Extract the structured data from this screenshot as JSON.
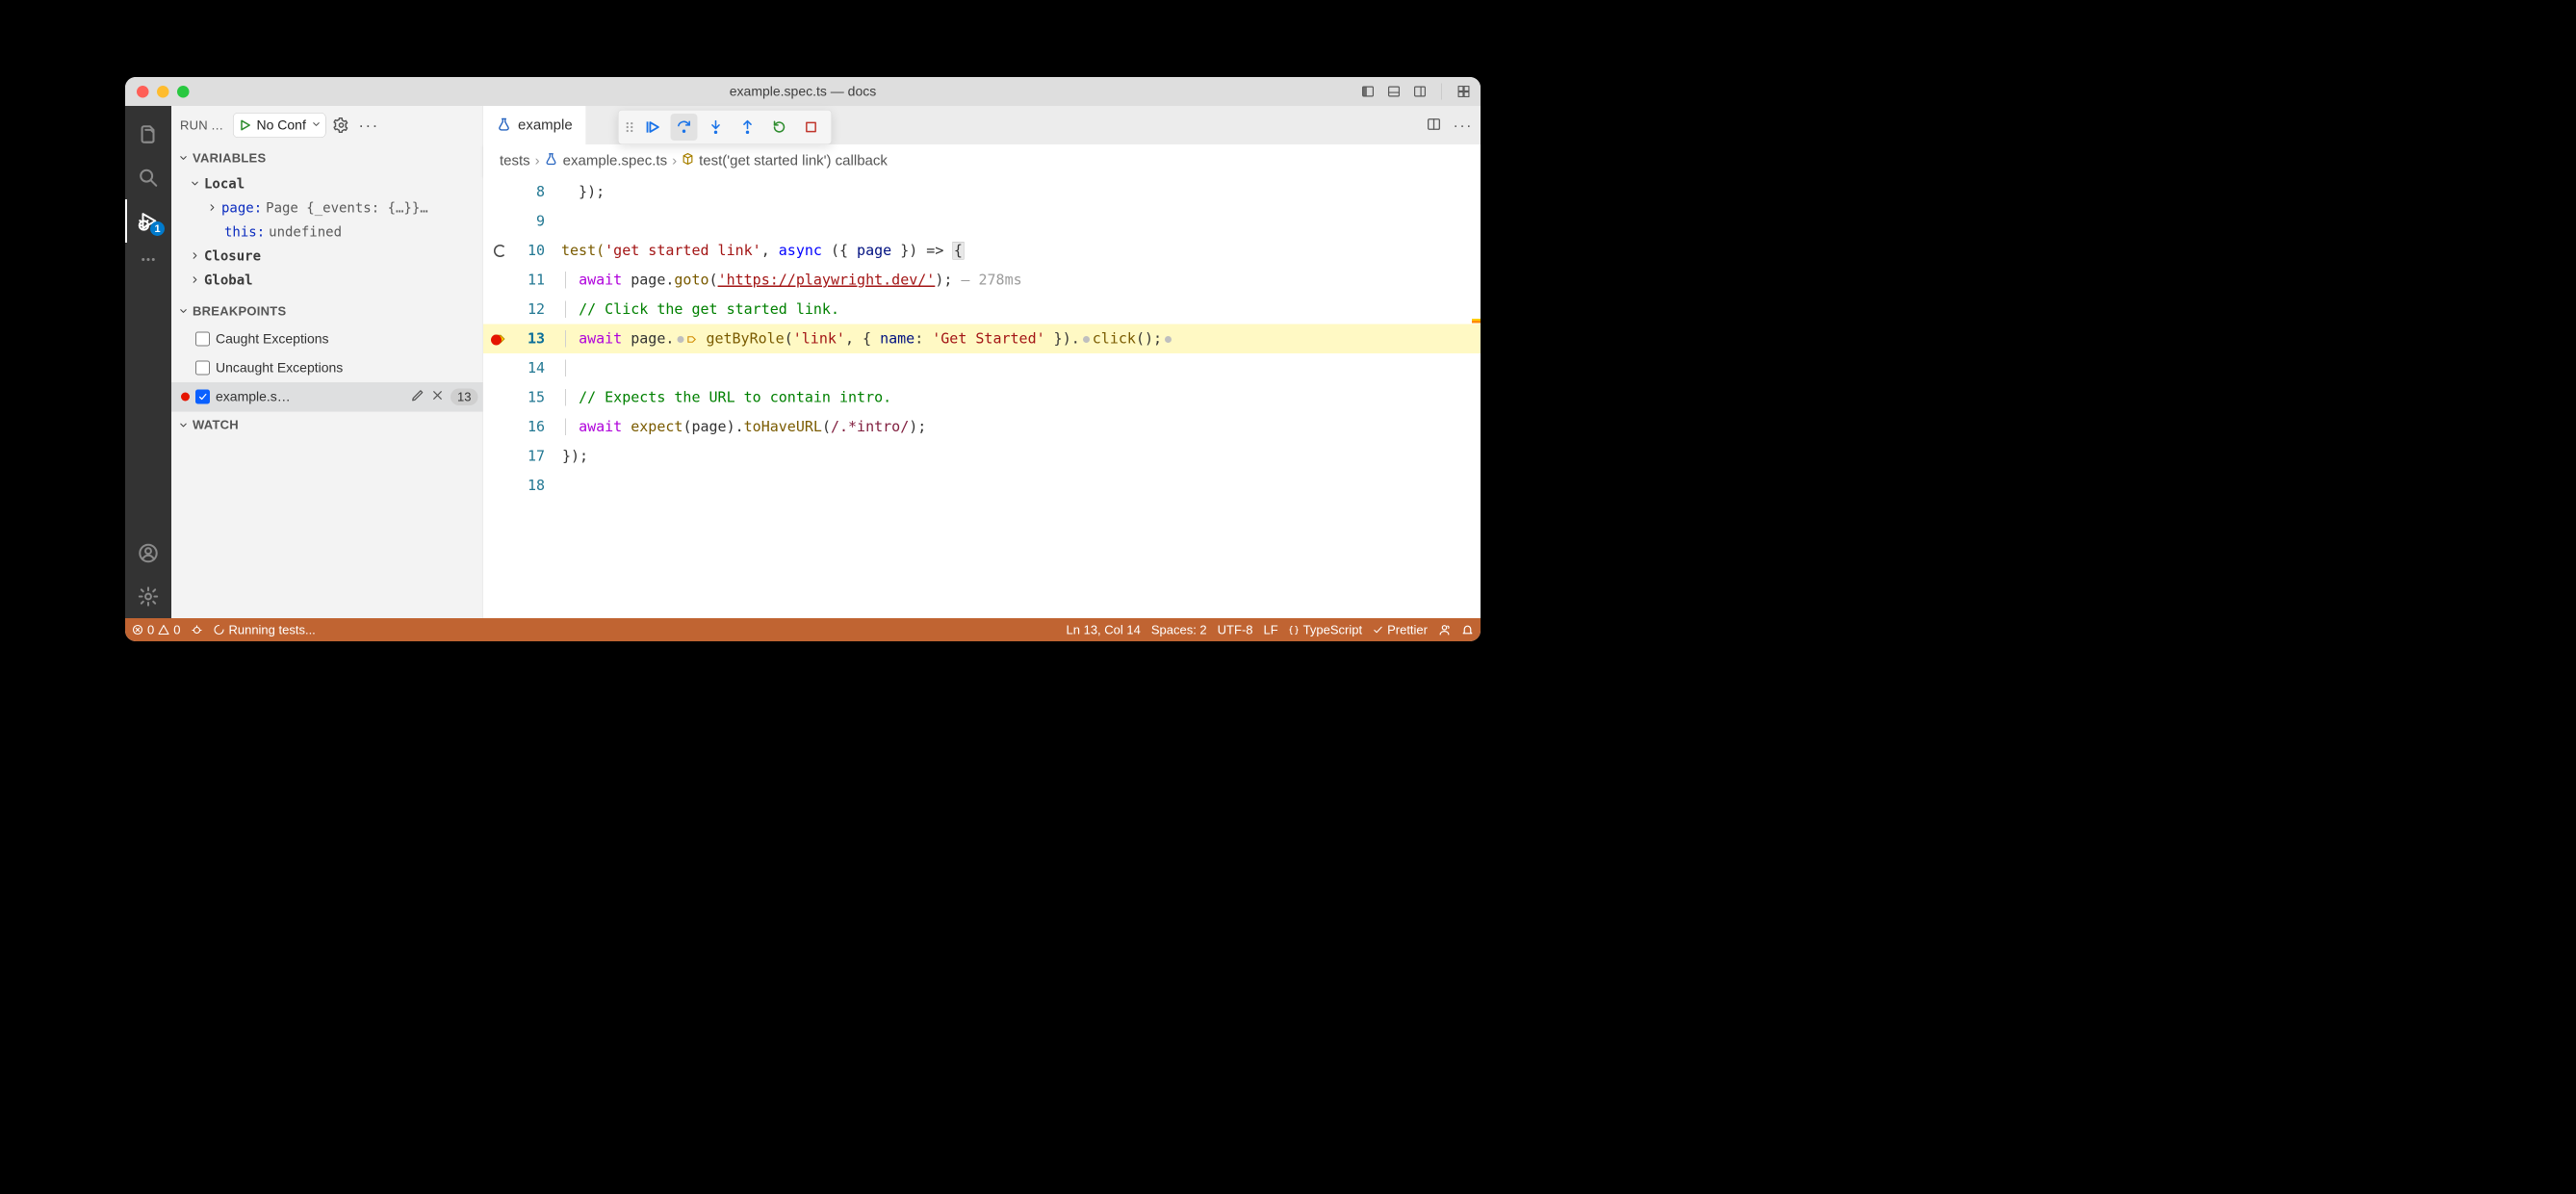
{
  "titlebar": {
    "title": "example.spec.ts — docs"
  },
  "activity": {
    "badge": "1"
  },
  "debug_panel": {
    "run_label": "RUN AND DEBUG",
    "configuration": "No Conf",
    "sections": {
      "variables": {
        "title": "VARIABLES",
        "local": "Local",
        "page_key": "page:",
        "page_val": "Page {_events: {…}}…",
        "this_key": "this:",
        "this_val": "undefined",
        "closure": "Closure",
        "global": "Global"
      },
      "breakpoints": {
        "title": "BREAKPOINTS",
        "caught": "Caught Exceptions",
        "uncaught": "Uncaught Exceptions",
        "row_name": "example.s…",
        "row_line": "13"
      },
      "watch": {
        "title": "WATCH"
      }
    }
  },
  "tabs": {
    "active": "example"
  },
  "breadcrumbs": {
    "a": "tests",
    "b": "example.spec.ts",
    "c": "test('get started link') callback"
  },
  "editor": {
    "l8": "  });",
    "l10_a": "test(",
    "l10_str": "'get started link'",
    "l10_b": ", ",
    "l10_async": "async",
    "l10_c": " ({ ",
    "l10_page": "page",
    "l10_d": " }) => ",
    "l10_brace": "{",
    "l11_a": "  ",
    "l11_await": "await",
    "l11_b": " page.",
    "l11_goto": "goto",
    "l11_c": "(",
    "l11_url": "'https://playwright.dev/'",
    "l11_d": ");",
    "l11_hint": " — 278ms",
    "l12_a": "  ",
    "l12_c": "// Click the get started link.",
    "l13_a": "  ",
    "l13_await": "await",
    "l13_b": " page.",
    "l13_fn": "getByRole",
    "l13_c": "(",
    "l13_s1": "'link'",
    "l13_d": ", { ",
    "l13_name": "name",
    "l13_e": ": ",
    "l13_s2": "'Get Started'",
    "l13_f": " }).",
    "l13_click": "click",
    "l13_g": "();",
    "l15_a": "  ",
    "l15_c": "// Expects the URL to contain intro.",
    "l16_a": "  ",
    "l16_await": "await",
    "l16_b": " ",
    "l16_expect": "expect",
    "l16_c": "(page).",
    "l16_to": "toHaveURL",
    "l16_d": "(",
    "l16_rx": "/.*intro/",
    "l16_e": ");",
    "l17": "});"
  },
  "status": {
    "errors": "0",
    "warnings": "0",
    "running": "Running tests...",
    "ln_col": "Ln 13, Col 14",
    "spaces": "Spaces: 2",
    "encoding": "UTF-8",
    "eol": "LF",
    "lang": "TypeScript",
    "prettier": "Prettier"
  }
}
